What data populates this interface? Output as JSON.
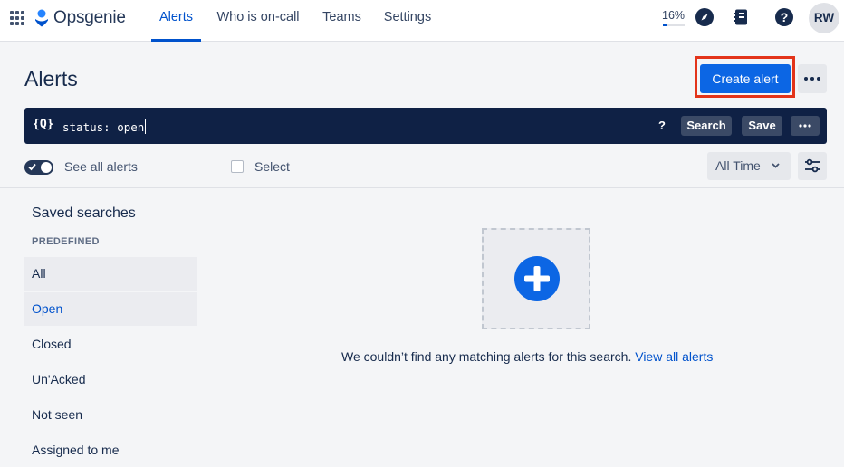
{
  "app": {
    "name": "Opsgenie",
    "brand_color": "#0052cc"
  },
  "nav": {
    "items": [
      {
        "label": "Alerts",
        "active": true
      },
      {
        "label": "Who is on-call",
        "active": false
      },
      {
        "label": "Teams",
        "active": false
      },
      {
        "label": "Settings",
        "active": false
      }
    ],
    "usage_percent": "16%",
    "icons": [
      "app-switcher-icon",
      "compass-icon",
      "book-icon",
      "help-icon"
    ],
    "avatar_initials": "RW"
  },
  "header": {
    "title": "Alerts",
    "create_button": "Create alert",
    "highlight_color": "#e3341a"
  },
  "search": {
    "icon_label": "{Q}",
    "query": "status: open",
    "help": "?",
    "search_button": "Search",
    "save_button": "Save",
    "bar_color": "#0f2145"
  },
  "toolbar": {
    "see_all_label": "See all alerts",
    "see_all_on": true,
    "select_label": "Select",
    "time_filter": "All Time"
  },
  "sidebar": {
    "title": "Saved searches",
    "section_label": "PREDEFINED",
    "items": [
      {
        "label": "All",
        "selected": false
      },
      {
        "label": "Open",
        "selected": true
      },
      {
        "label": "Closed",
        "selected": false
      },
      {
        "label": "Un'Acked",
        "selected": false
      },
      {
        "label": "Not seen",
        "selected": false
      },
      {
        "label": "Assigned to me",
        "selected": false
      }
    ]
  },
  "empty_state": {
    "message": "We couldn’t find any matching alerts for this search.",
    "link": "View all alerts"
  }
}
